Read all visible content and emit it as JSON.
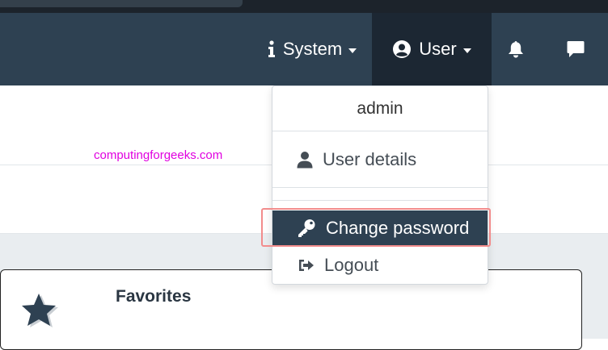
{
  "navbar": {
    "system_label": "System",
    "user_label": "User",
    "icons": {
      "system": "info-icon",
      "user": "user-circle-icon",
      "bell": "bell-icon",
      "chat": "chat-icon"
    }
  },
  "watermark": "computingforgeeks.com",
  "dropdown": {
    "header": "admin",
    "items": [
      {
        "label": "User details",
        "icon": "user-icon"
      },
      {
        "label": "Change password",
        "icon": "key-icon",
        "active": true
      },
      {
        "label": "Logout",
        "icon": "logout-icon"
      }
    ]
  },
  "card": {
    "title": "Favorites",
    "icon": "star-icon"
  },
  "colors": {
    "navbar": "#2e4152",
    "navbar_active": "#1c2733",
    "highlight_border": "#f28c8c",
    "watermark": "#e000e0"
  }
}
